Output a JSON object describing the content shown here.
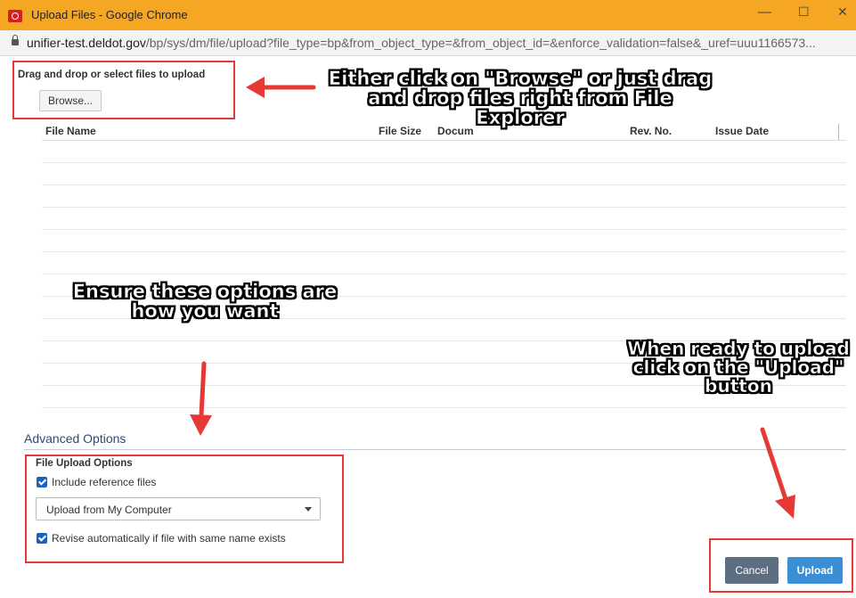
{
  "window": {
    "title": "Upload Files - Google Chrome",
    "minimize_glyph": "—",
    "maximize_glyph": "☐",
    "close_glyph": "✕"
  },
  "address_bar": {
    "domain": "unifier-test.deldot.gov",
    "path": "/bp/sys/dm/file/upload?file_type=bp&from_object_type=&from_object_id=&enforce_validation=false&_uref=uuu1166573..."
  },
  "upload_area": {
    "label": "Drag and drop or select files to upload",
    "browse_label": "Browse..."
  },
  "file_table": {
    "columns": [
      "File Name",
      "File Size",
      "Docum",
      "Rev. No.",
      "Issue Date"
    ],
    "row_count": 12
  },
  "advanced": {
    "heading": "Advanced Options",
    "group_label": "File Upload Options",
    "include_reference_label": "Include reference files",
    "include_reference_checked": true,
    "source_select_value": "Upload from My Computer",
    "revise_label": "Revise automatically if file with same name exists",
    "revise_checked": true
  },
  "footer": {
    "cancel_label": "Cancel",
    "upload_label": "Upload"
  },
  "annotations": {
    "browse_tip_lines": [
      "Either click on \"Browse\" or just drag",
      "and drop files right from File",
      "Explorer"
    ],
    "options_tip_lines": [
      "Ensure these options are",
      "how you want"
    ],
    "upload_tip_lines": [
      "When ready to upload",
      "click on the \"Upload\"",
      "button"
    ]
  },
  "colors": {
    "titlebar": "#f5a623",
    "highlight_box": "#e53935",
    "checkbox": "#1565c0",
    "cancel_button": "#5d6e80",
    "upload_button": "#3a8ed6"
  }
}
